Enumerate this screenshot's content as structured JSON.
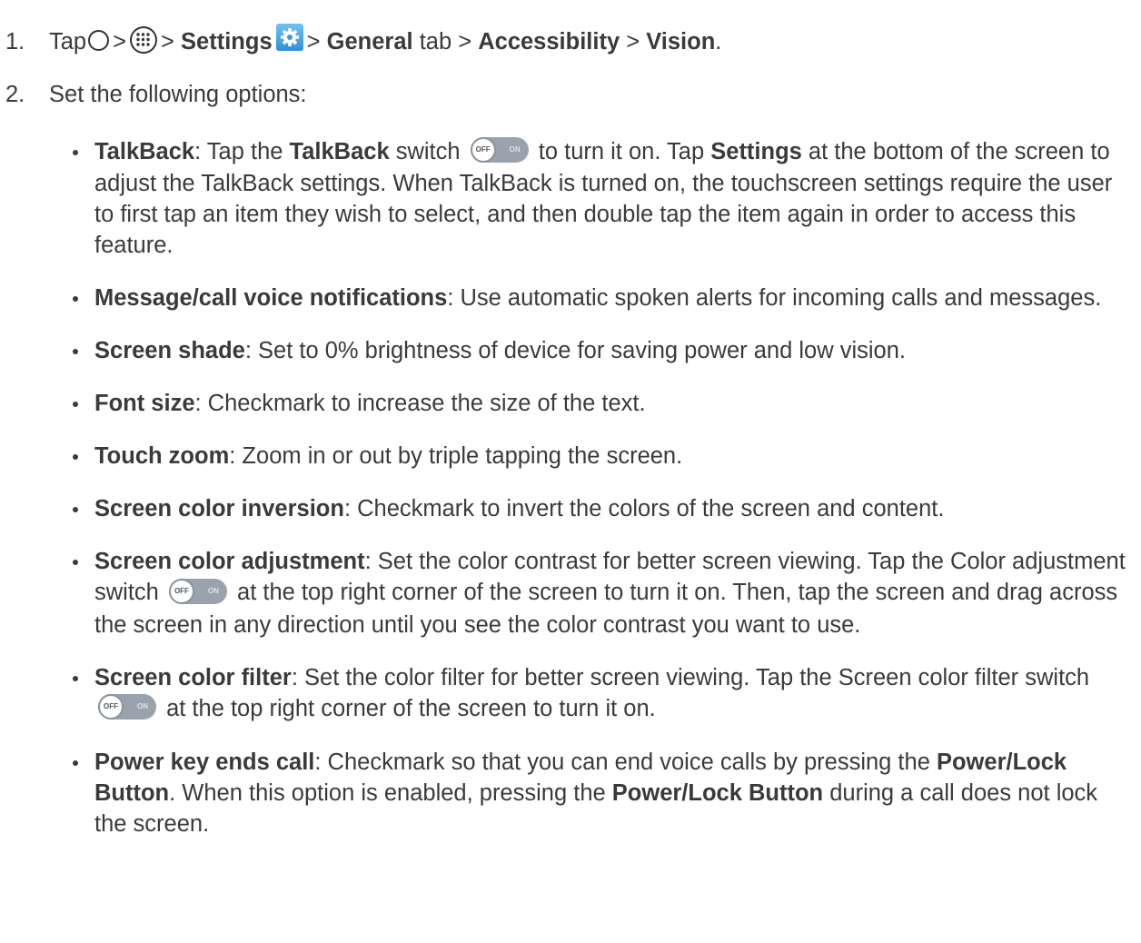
{
  "step1": {
    "num": "1.",
    "tap": "Tap",
    "sep1": ">",
    "sep2": ">",
    "settings": "Settings",
    "sep3": ">",
    "general": "General",
    "tab": "tab >",
    "accessibility": "Accessibility",
    "sep4": ">",
    "vision": "Vision",
    "end": "."
  },
  "step2": {
    "num": "2.",
    "text": "Set the following options:"
  },
  "toggle": {
    "off": "OFF",
    "on": "ON"
  },
  "items": [
    {
      "title": "TalkBack",
      "t1": ": Tap the ",
      "b1": "TalkBack",
      "t2": " switch ",
      "t3": " to turn it on. Tap ",
      "b2": "Settings",
      "t4": " at the bottom of the screen to adjust the TalkBack settings. When TalkBack is turned on, the touchscreen settings require the user to first tap an item they wish to select, and then double tap the item again in order to access this feature."
    },
    {
      "title": "Message/call voice notifications",
      "text": ": Use automatic spoken alerts for incoming calls and messages."
    },
    {
      "title": "Screen shade",
      "text": ": Set to 0% brightness of device for saving power and low vision."
    },
    {
      "title": "Font size",
      "text": ": Checkmark to increase the size of the text."
    },
    {
      "title": "Touch zoom",
      "text": ": Zoom in or out by triple tapping the screen."
    },
    {
      "title": "Screen color inversion",
      "text": ": Checkmark to invert the colors of the screen and content."
    },
    {
      "title": "Screen color adjustment",
      "t1": ": Set the color contrast for better screen viewing. Tap the Color adjustment switch ",
      "t2": " at the top right corner of the screen to turn it on. Then, tap the screen and drag across the screen in any direction until you see the color contrast you want to use."
    },
    {
      "title": "Screen color filter",
      "t1": ": Set the color filter for better screen viewing. Tap the Screen color filter switch ",
      "t2": " at the top right corner of the screen to turn it on."
    },
    {
      "title": "Power key ends call",
      "t1": ": Checkmark so that you can end voice calls by pressing the ",
      "b1": "Power/Lock Button",
      "t2": ". When this option is enabled, pressing the ",
      "b2": "Power/Lock Button",
      "t3": " during a call does not lock the screen."
    }
  ]
}
